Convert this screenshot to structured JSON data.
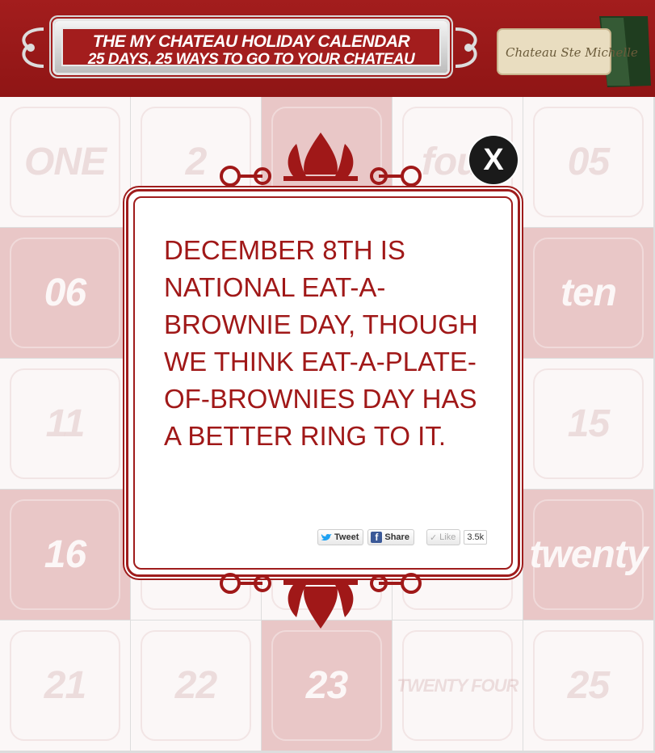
{
  "header": {
    "title_line1": "THE MY CHATEAU HOLIDAY CALENDAR",
    "title_line2": "25 DAYS, 25 WAYS TO GO TO YOUR CHATEAU",
    "cork_brand": "Chateau Ste Michelle"
  },
  "tiles": [
    {
      "label": "ONE",
      "style": "light"
    },
    {
      "label": "2",
      "style": "light"
    },
    {
      "label": "",
      "style": "pink"
    },
    {
      "label": "four",
      "style": "light"
    },
    {
      "label": "05",
      "style": "light"
    },
    {
      "label": "06",
      "style": "pink"
    },
    {
      "label": "",
      "style": "light"
    },
    {
      "label": "",
      "style": "light"
    },
    {
      "label": "",
      "style": "light"
    },
    {
      "label": "ten",
      "style": "pink"
    },
    {
      "label": "11",
      "style": "light"
    },
    {
      "label": "",
      "style": "light"
    },
    {
      "label": "",
      "style": "light"
    },
    {
      "label": "",
      "style": "light"
    },
    {
      "label": "15",
      "style": "light"
    },
    {
      "label": "16",
      "style": "pink"
    },
    {
      "label": "",
      "style": "light"
    },
    {
      "label": "",
      "style": "light"
    },
    {
      "label": "",
      "style": "light"
    },
    {
      "label": "twenty",
      "style": "pink"
    },
    {
      "label": "21",
      "style": "light"
    },
    {
      "label": "22",
      "style": "light"
    },
    {
      "label": "23",
      "style": "pink"
    },
    {
      "label": "TWENTY FOUR",
      "style": "light"
    },
    {
      "label": "25",
      "style": "light"
    }
  ],
  "modal": {
    "message": "DECEMBER 8TH IS NATIONAL EAT-A-BROWNIE DAY, THOUGH WE THINK EAT-A-PLATE-OF-BROWNIES DAY HAS A BETTER RING TO IT.",
    "close_label": "X",
    "tweet_label": "Tweet",
    "share_label": "Share",
    "like_label": "Like",
    "like_count": "3.5k"
  },
  "colors": {
    "brand_red": "#9f1c1c",
    "tile_pink": "#e9c7c7",
    "tile_light": "#fbf7f7"
  },
  "icons": [
    "twitter-bird-icon",
    "facebook-icon",
    "like-check-icon",
    "close-icon"
  ]
}
